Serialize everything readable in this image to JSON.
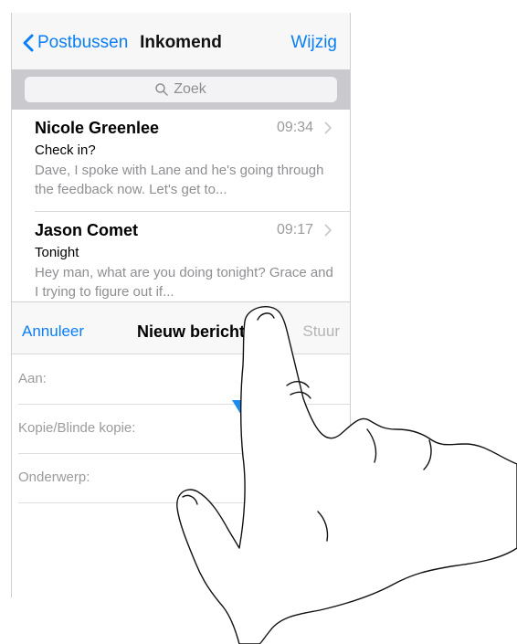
{
  "inbox": {
    "back_label": "Postbussen",
    "title": "Inkomend",
    "edit_label": "Wijzig",
    "search_placeholder": "Zoek",
    "messages": [
      {
        "from": "Nicole Greenlee",
        "time": "09:34",
        "subject": "Check in?",
        "preview": "Dave, I spoke with Lane and he's going through the feedback now. Let's get to..."
      },
      {
        "from": "Jason Comet",
        "time": "09:17",
        "subject": "Tonight",
        "preview": "Hey man, what are you doing tonight? Grace and I trying to figure out if..."
      }
    ]
  },
  "compose": {
    "cancel_label": "Annuleer",
    "title": "Nieuw bericht",
    "send_label": "Stuur",
    "fields": {
      "to": "Aan:",
      "cc_bcc": "Kopie/Blinde kopie:",
      "subject": "Onderwerp:"
    }
  },
  "colors": {
    "accent": "#0a7ef6",
    "arrow": "#1a8cf0"
  },
  "icons": {
    "back": "chevron-left-icon",
    "search": "magnifier-icon",
    "disclosure": "chevron-right-icon",
    "gesture": "hand-swipe-down",
    "direction": "arrow-down-icon"
  }
}
